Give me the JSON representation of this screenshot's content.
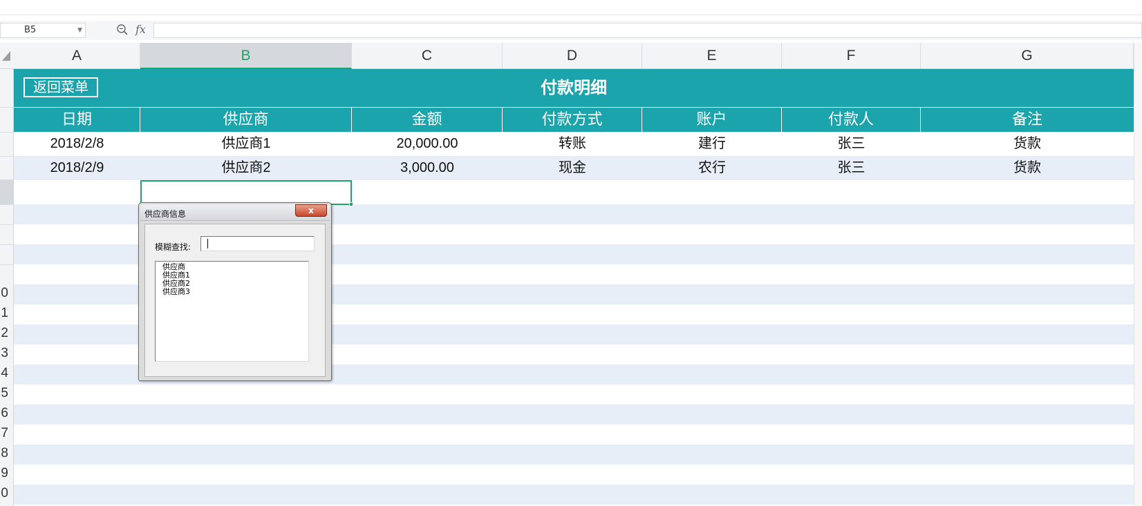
{
  "formula_bar": {
    "cell_ref": "B5",
    "fx_label": "fx",
    "formula": ""
  },
  "columns": [
    "A",
    "B",
    "C",
    "D",
    "E",
    "F",
    "G"
  ],
  "selected_column": "B",
  "row_numbers": [
    "0",
    "1",
    "2",
    "3",
    "4",
    "5",
    "6",
    "7",
    "8",
    "9",
    "0"
  ],
  "sheet": {
    "title": "付款明细",
    "menu_button": "返回菜单",
    "headers": [
      "日期",
      "供应商",
      "金额",
      "付款方式",
      "账户",
      "付款人",
      "备注"
    ],
    "rows": [
      [
        "2018/2/8",
        "供应商1",
        "20,000.00",
        "转账",
        "建行",
        "张三",
        "货款"
      ],
      [
        "2018/2/9",
        "供应商2",
        "3,000.00",
        "现金",
        "农行",
        "张三",
        "货款"
      ]
    ]
  },
  "dialog": {
    "title": "供应商信息",
    "close_label": "x",
    "search_label": "模糊查找:",
    "search_value": "",
    "list_items": [
      "供应商",
      "供应商1",
      "供应商2",
      "供应商3"
    ]
  },
  "colors": {
    "teal": "#1ba4ac",
    "band": "#e8eef8",
    "selection": "#20a36a"
  }
}
